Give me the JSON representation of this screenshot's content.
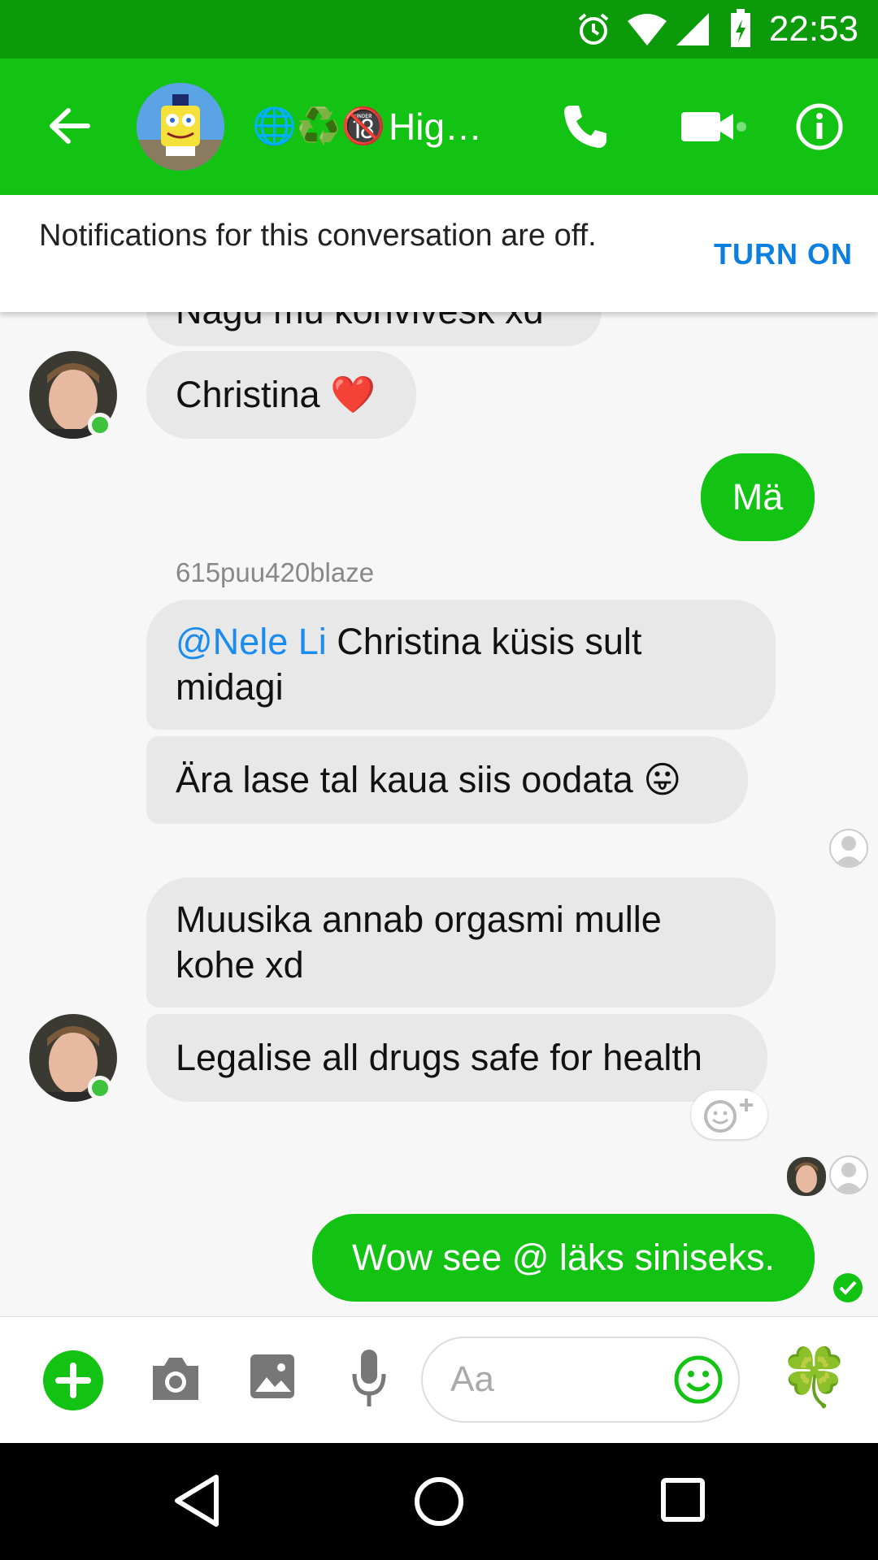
{
  "status_bar": {
    "time": "22:53"
  },
  "header": {
    "back_icon": "arrow-left-icon",
    "title_emoji": "🌐♻️🔞",
    "title": "Hig…",
    "call_icon": "phone-icon",
    "video_icon": "video-camera-icon",
    "info_icon": "info-icon"
  },
  "notification_banner": {
    "text": "Notifications for this conversation are off.",
    "action": "TURN ON"
  },
  "messages": {
    "cut_off_top": "Nagu mu kohvivesk xd",
    "m1": "Christina",
    "m1_emoji": "❤️",
    "m2": "Mä",
    "sender_name": "615puu420blaze",
    "m3_mention": "@Nele Li",
    "m3_rest": " Christina küsis sult midagi",
    "m4": "Ära lase tal kaua siis oodata",
    "m4_emoji": "😛",
    "m5": "Muusika annab orgasmi mulle kohe xd",
    "m6": "Legalise all drugs safe for health",
    "m7": "Wow see @ läks siniseks."
  },
  "composer": {
    "placeholder": "Aa",
    "clover": "🍀"
  },
  "colors": {
    "brand_green": "#13c313",
    "status_green": "#0a9a0a",
    "link_blue": "#1a8cf0",
    "bubble_gray": "#e8e8e8"
  }
}
